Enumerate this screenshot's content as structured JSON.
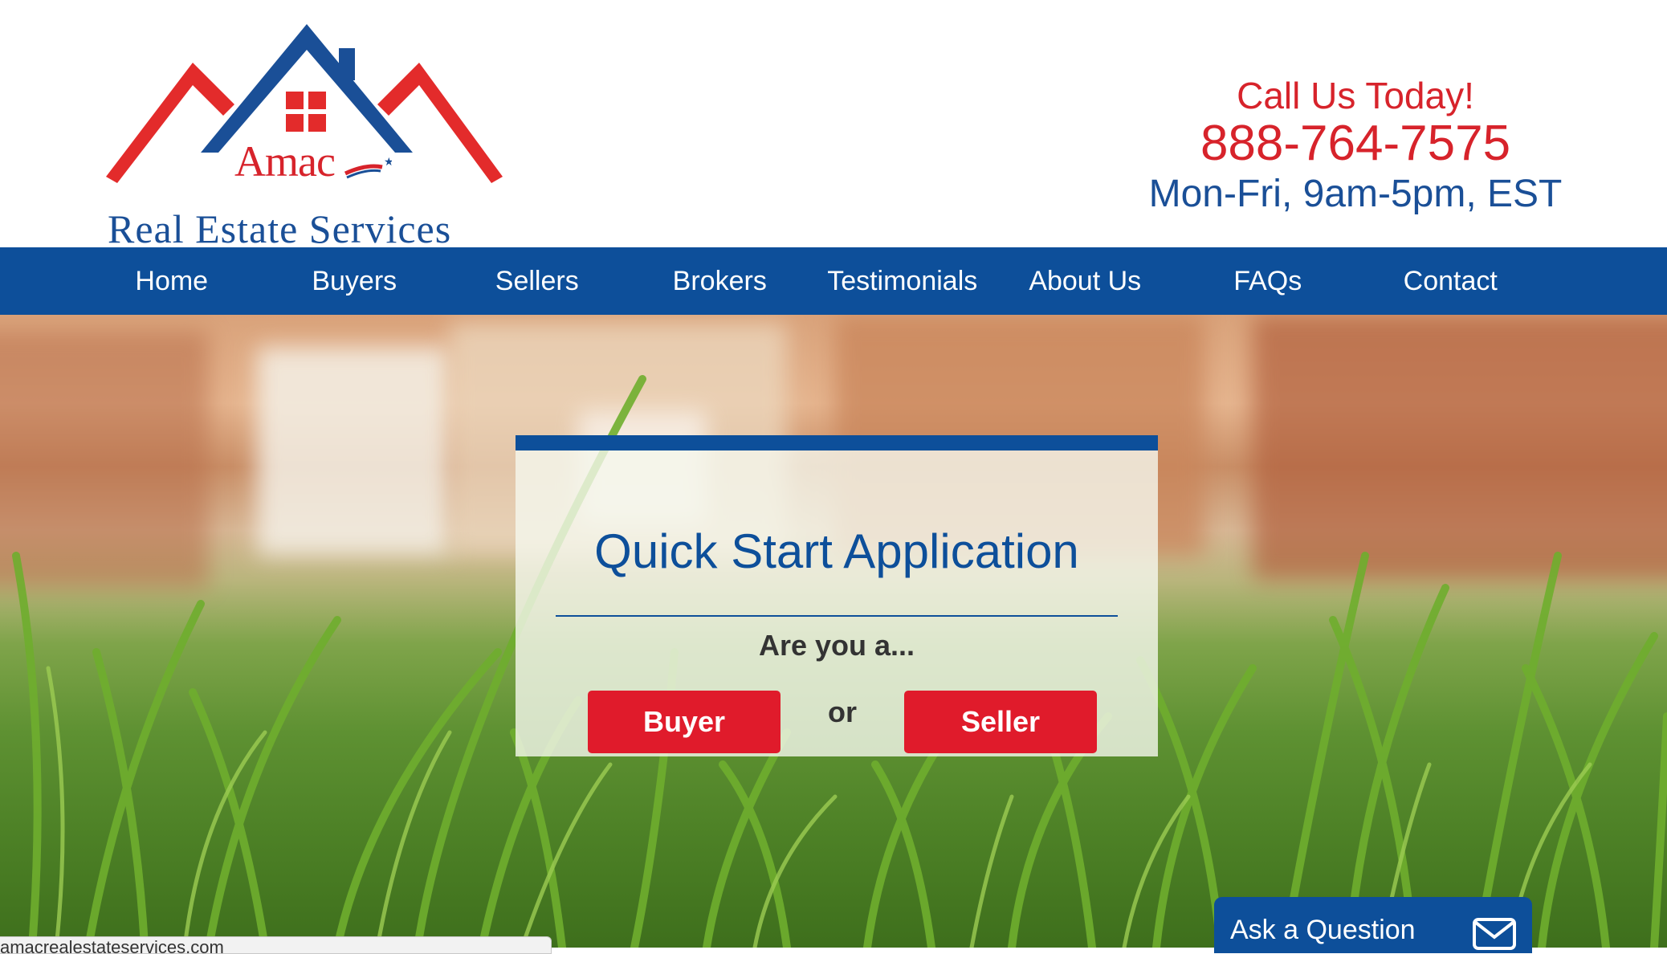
{
  "logo": {
    "brand": "Amac",
    "tagline": "Real Estate Services",
    "icon": "house-roofs-logo"
  },
  "contact": {
    "call_label": "Call Us Today!",
    "phone": "888-764-7575",
    "hours": "Mon-Fri, 9am-5pm, EST"
  },
  "nav": {
    "items": [
      {
        "label": "Home"
      },
      {
        "label": "Buyers"
      },
      {
        "label": "Sellers"
      },
      {
        "label": "Brokers"
      },
      {
        "label": "Testimonials"
      },
      {
        "label": "About Us"
      },
      {
        "label": "FAQs"
      },
      {
        "label": "Contact"
      }
    ]
  },
  "quick_start": {
    "title": "Quick Start Application",
    "question": "Are you a...",
    "buyer_label": "Buyer",
    "or_label": "or",
    "seller_label": "Seller"
  },
  "ask": {
    "label": "Ask a Question",
    "icon": "envelope-icon"
  },
  "status_bar": {
    "url": "amacrealestateservices.com"
  },
  "colors": {
    "brand_blue": "#0d4f9a",
    "brand_red": "#d7232b",
    "button_red": "#e01b2b"
  }
}
